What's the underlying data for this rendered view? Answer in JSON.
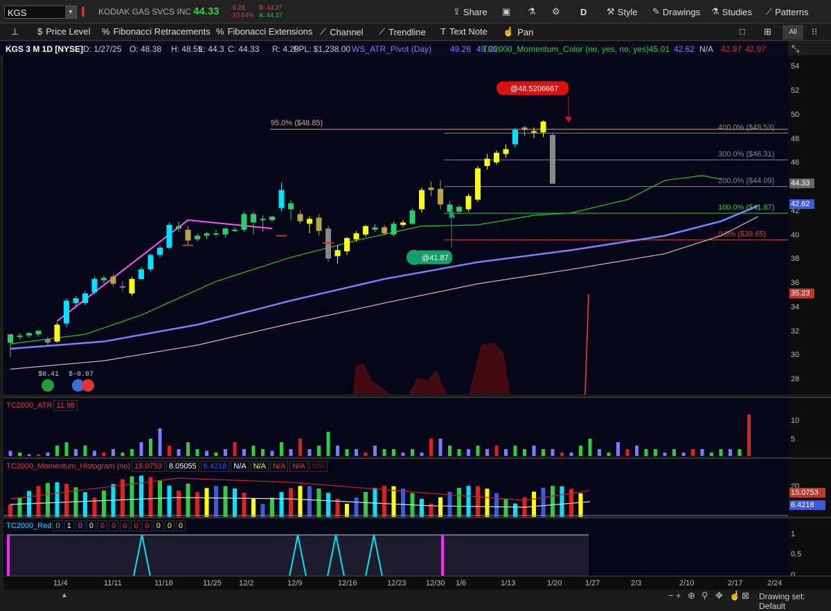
{
  "header": {
    "symbol": "KGS",
    "company": "KODIAK GAS SVCS INC",
    "last": "44.33",
    "change": "-5.28",
    "change_pct": "-10.64%",
    "bid": "B: 44.27",
    "ask": "A: 44.37",
    "buttons": {
      "share": "Share",
      "period": "D",
      "style": "Style",
      "drawings": "Drawings",
      "studies": "Studies",
      "patterns": "Patterns"
    }
  },
  "tools": {
    "price_level": "Price Level",
    "fib_ret": "Fibonacci Retracements",
    "fib_ext": "Fibonacci Extensions",
    "channel": "Channel",
    "trendline": "Trendline",
    "text_note": "Text Note",
    "pan": "Pan",
    "all": "All"
  },
  "info": {
    "title": "KGS 3 M 1D [NYSE]",
    "date": "D: 1/27/25",
    "open": "O: 48.38",
    "high": "H: 48.59",
    "low": "L: 44.3",
    "close": "C: 44.33",
    "range": "R: 4.29",
    "fpl": "FPL: $1,238.00",
    "pivot_name": "WS_ATR_Pivot (Day)",
    "pivot_v1": "49.26",
    "pivot_v2": "49.96",
    "mom_name": "TC2000_Momentum_Color (no, yes, no, yes)",
    "mom_v1": "45.01",
    "mom_v2": "42.62",
    "mom_na": "N/A",
    "mom_v3": "42.97",
    "mom_v4": "42.97"
  },
  "chart_data": {
    "type": "candlestick",
    "y_ticks": [
      "54",
      "52",
      "50",
      "48",
      "46",
      "44",
      "42",
      "40",
      "38",
      "36",
      "34",
      "32",
      "30",
      "28"
    ],
    "ylim": [
      26.8,
      55
    ],
    "x_ticks": [
      "11/4",
      "11/11",
      "11/18",
      "11/25",
      "12/2",
      "12/9",
      "12/16",
      "12/23",
      "12/30",
      "1/6",
      "1/13",
      "1/20",
      "1/27",
      "2/3",
      "2/10",
      "2/17",
      "2/24"
    ],
    "candles": [
      {
        "o": 31.1,
        "h": 31.8,
        "l": 29.9,
        "c": 31.8,
        "k": "#2ecc71"
      },
      {
        "o": 31.6,
        "h": 31.9,
        "l": 31.4,
        "c": 31.7,
        "k": "#2ecc71"
      },
      {
        "o": 31.7,
        "h": 32.0,
        "l": 31.5,
        "c": 31.9,
        "k": "#2ecc71"
      },
      {
        "o": 31.8,
        "h": 32.1,
        "l": 31.6,
        "c": 32.1,
        "k": "#2ecc71"
      },
      {
        "o": 31.4,
        "h": 31.6,
        "l": 30.9,
        "c": 31.1,
        "k": "#888888"
      },
      {
        "o": 31.2,
        "h": 32.8,
        "l": 31.1,
        "c": 32.6,
        "k": "#ffff00"
      },
      {
        "o": 32.7,
        "h": 34.8,
        "l": 32.4,
        "c": 34.6,
        "k": "#00e5ff"
      },
      {
        "o": 34.4,
        "h": 35.0,
        "l": 34.0,
        "c": 34.8,
        "k": "#00e5ff"
      },
      {
        "o": 34.4,
        "h": 35.4,
        "l": 34.2,
        "c": 35.2,
        "k": "#00e5ff"
      },
      {
        "o": 35.3,
        "h": 36.6,
        "l": 35.1,
        "c": 36.4,
        "k": "#00e5ff"
      },
      {
        "o": 36.3,
        "h": 36.7,
        "l": 36.0,
        "c": 36.5,
        "k": "#2ecc71"
      },
      {
        "o": 36.6,
        "h": 36.8,
        "l": 35.8,
        "c": 36.0,
        "k": "#b5a642"
      },
      {
        "o": 35.7,
        "h": 36.2,
        "l": 35.4,
        "c": 35.8,
        "k": "#888888"
      },
      {
        "o": 35.2,
        "h": 36.6,
        "l": 35.0,
        "c": 36.4,
        "k": "#ffff00"
      },
      {
        "o": 36.4,
        "h": 37.4,
        "l": 36.3,
        "c": 37.2,
        "k": "#00e5ff"
      },
      {
        "o": 37.2,
        "h": 38.5,
        "l": 37.0,
        "c": 38.4,
        "k": "#00e5ff"
      },
      {
        "o": 38.4,
        "h": 39.2,
        "l": 38.2,
        "c": 39.0,
        "k": "#00e5ff"
      },
      {
        "o": 39.0,
        "h": 41.1,
        "l": 38.9,
        "c": 40.9,
        "k": "#00e5ff"
      },
      {
        "o": 40.8,
        "h": 41.2,
        "l": 40.3,
        "c": 40.6,
        "k": "#2ecc71"
      },
      {
        "o": 40.5,
        "h": 40.8,
        "l": 39.2,
        "c": 39.6,
        "k": "#b5a642"
      },
      {
        "o": 39.7,
        "h": 40.2,
        "l": 39.5,
        "c": 40.0,
        "k": "#2ecc71"
      },
      {
        "o": 40.0,
        "h": 40.3,
        "l": 39.7,
        "c": 40.2,
        "k": "#2ecc71"
      },
      {
        "o": 40.2,
        "h": 40.5,
        "l": 39.9,
        "c": 40.1,
        "k": "#2ecc71"
      },
      {
        "o": 40.1,
        "h": 40.7,
        "l": 39.8,
        "c": 40.6,
        "k": "#2ecc71"
      },
      {
        "o": 40.5,
        "h": 40.7,
        "l": 40.3,
        "c": 40.4,
        "k": "#2ecc71"
      },
      {
        "o": 40.5,
        "h": 42.0,
        "l": 40.3,
        "c": 41.8,
        "k": "#2ecc71"
      },
      {
        "o": 41.8,
        "h": 42.0,
        "l": 40.1,
        "c": 41.1,
        "k": "#2ecc71"
      },
      {
        "o": 41.4,
        "h": 41.7,
        "l": 40.3,
        "c": 41.4,
        "k": "#2ecc71"
      },
      {
        "o": 41.3,
        "h": 41.6,
        "l": 41.1,
        "c": 41.6,
        "k": "#2ecc71"
      },
      {
        "o": 42.3,
        "h": 44.4,
        "l": 42.0,
        "c": 43.8,
        "k": "#00e5ff"
      },
      {
        "o": 42.2,
        "h": 43.0,
        "l": 41.3,
        "c": 42.7,
        "k": "#2ecc71"
      },
      {
        "o": 41.8,
        "h": 42.1,
        "l": 41.0,
        "c": 41.2,
        "k": "#b5a642"
      },
      {
        "o": 41.0,
        "h": 41.6,
        "l": 40.2,
        "c": 41.4,
        "k": "#ffff00"
      },
      {
        "o": 41.5,
        "h": 41.8,
        "l": 40.0,
        "c": 40.4,
        "k": "#b5a642"
      },
      {
        "o": 40.6,
        "h": 40.8,
        "l": 37.8,
        "c": 38.1,
        "k": "#888888"
      },
      {
        "o": 38.3,
        "h": 39.2,
        "l": 37.7,
        "c": 38.8,
        "k": "#ffff00"
      },
      {
        "o": 38.7,
        "h": 39.9,
        "l": 38.4,
        "c": 39.8,
        "k": "#ffff00"
      },
      {
        "o": 39.7,
        "h": 40.4,
        "l": 39.5,
        "c": 40.2,
        "k": "#ffff00"
      },
      {
        "o": 40.1,
        "h": 40.9,
        "l": 39.9,
        "c": 40.8,
        "k": "#ffff00"
      },
      {
        "o": 40.5,
        "h": 41.0,
        "l": 40.3,
        "c": 40.7,
        "k": "#2ecc71"
      },
      {
        "o": 40.7,
        "h": 40.9,
        "l": 40.0,
        "c": 40.2,
        "k": "#b5a642"
      },
      {
        "o": 40.1,
        "h": 41.2,
        "l": 39.9,
        "c": 41.0,
        "k": "#2ecc71"
      },
      {
        "o": 40.9,
        "h": 41.3,
        "l": 40.7,
        "c": 41.1,
        "k": "#ffff00"
      },
      {
        "o": 41.0,
        "h": 42.3,
        "l": 40.9,
        "c": 42.1,
        "k": "#2ecc71"
      },
      {
        "o": 42.2,
        "h": 44.0,
        "l": 41.9,
        "c": 43.8,
        "k": "#ffff00"
      },
      {
        "o": 43.8,
        "h": 44.5,
        "l": 43.3,
        "c": 44.0,
        "k": "#b5a642"
      },
      {
        "o": 43.9,
        "h": 44.6,
        "l": 42.2,
        "c": 42.6,
        "k": "#b5a642"
      },
      {
        "o": 42.6,
        "h": 42.9,
        "l": 41.6,
        "c": 42.0,
        "k": "#2ecc71"
      },
      {
        "o": 42.0,
        "h": 42.6,
        "l": 41.8,
        "c": 42.4,
        "k": "#2ecc71"
      },
      {
        "o": 42.2,
        "h": 43.5,
        "l": 42.0,
        "c": 43.3,
        "k": "#ffff00"
      },
      {
        "o": 43.0,
        "h": 45.8,
        "l": 42.8,
        "c": 45.6,
        "k": "#ffff00"
      },
      {
        "o": 45.8,
        "h": 46.8,
        "l": 45.5,
        "c": 46.4,
        "k": "#ffff00"
      },
      {
        "o": 46.1,
        "h": 47.1,
        "l": 45.9,
        "c": 46.9,
        "k": "#ffff00"
      },
      {
        "o": 46.8,
        "h": 47.6,
        "l": 46.5,
        "c": 47.2,
        "k": "#ffff00"
      },
      {
        "o": 47.6,
        "h": 49.0,
        "l": 47.3,
        "c": 48.8,
        "k": "#00e5ff"
      },
      {
        "o": 48.8,
        "h": 49.1,
        "l": 48.3,
        "c": 49.0,
        "k": "#b5a642"
      },
      {
        "o": 48.6,
        "h": 49.0,
        "l": 48.1,
        "c": 48.7,
        "k": "#ffff00"
      },
      {
        "o": 48.6,
        "h": 49.6,
        "l": 48.2,
        "c": 49.5,
        "k": "#ffff00"
      },
      {
        "o": 48.38,
        "h": 48.59,
        "l": 44.3,
        "c": 44.33,
        "k": "#888888"
      }
    ],
    "ma_green": [
      [
        0,
        31.0
      ],
      [
        8,
        31.8
      ],
      [
        14,
        33.4
      ],
      [
        22,
        36.2
      ],
      [
        30,
        38.2
      ],
      [
        37,
        39.6
      ],
      [
        44,
        40.8
      ],
      [
        50,
        40.9
      ],
      [
        56,
        41.7
      ],
      [
        60,
        41.9
      ],
      [
        66,
        43.0
      ],
      [
        70,
        44.6
      ],
      [
        74,
        45.0
      ],
      [
        76,
        44.7
      ]
    ],
    "ma_blue": [
      [
        0,
        30.6
      ],
      [
        10,
        31.2
      ],
      [
        20,
        32.6
      ],
      [
        30,
        34.6
      ],
      [
        40,
        36.4
      ],
      [
        50,
        37.8
      ],
      [
        60,
        38.8
      ],
      [
        70,
        40.0
      ],
      [
        76,
        41.2
      ],
      [
        80,
        42.5
      ]
    ],
    "ma_pink": [
      [
        0,
        28.9
      ],
      [
        10,
        29.6
      ],
      [
        20,
        30.9
      ],
      [
        30,
        32.7
      ],
      [
        40,
        34.4
      ],
      [
        50,
        36.0
      ],
      [
        60,
        37.2
      ],
      [
        70,
        38.5
      ],
      [
        76,
        40.0
      ],
      [
        80,
        41.6
      ]
    ],
    "fib_levels": [
      {
        "label": "400.0%  ($48.53)",
        "price": 48.53,
        "color": "#888888"
      },
      {
        "label": "300.0%  ($46.31)",
        "price": 46.31,
        "color": "#888888"
      },
      {
        "label": "200.0%  ($44.09)",
        "price": 44.09,
        "color": "#888888"
      },
      {
        "label": "100.0%  ($41.87)",
        "price": 41.87,
        "color": "#2ecc40"
      },
      {
        "label": "0.0%  ($39.65)",
        "price": 39.65,
        "color": "#e04040"
      }
    ],
    "fib_ret": {
      "label": "95.0%  ($48.85)",
      "price": 48.85
    },
    "alert_top": "@48.5206667",
    "alert_bottom": "@41.87",
    "price_tags": [
      {
        "v": "44.33",
        "color": "#666666"
      },
      {
        "v": "42.62",
        "color": "#3b5bdb"
      },
      {
        "v": "35.23",
        "color": "#c0392b"
      }
    ],
    "dividends": [
      "$0.41",
      "$-0.07"
    ]
  },
  "atr_pane": {
    "title": "TC2000_ATR",
    "value": "11.98",
    "ticks": [
      "10",
      "5"
    ],
    "values": [
      1.5,
      1,
      0.5,
      0.5,
      1,
      3,
      4,
      2,
      3,
      1.5,
      1,
      2,
      1,
      2,
      4,
      5,
      8,
      3,
      2,
      4,
      2,
      1.5,
      1,
      2,
      4,
      2,
      3,
      2,
      1.5,
      4,
      2,
      5,
      2,
      3,
      7,
      3,
      2,
      2,
      1,
      3,
      2,
      2,
      1,
      2,
      1,
      5,
      5,
      3,
      2,
      2,
      3,
      2,
      3,
      2,
      3,
      2,
      3,
      2,
      2,
      1,
      1,
      3,
      5,
      2,
      1,
      4,
      2,
      3,
      2,
      2,
      1,
      2,
      1,
      2,
      2,
      1,
      2,
      2,
      2,
      12
    ],
    "colors": [
      "#7b7bff",
      "#2ecc40",
      "#7b7bff",
      "#e02020",
      "#7b7bff",
      "#2ecc40",
      "#2ecc40"
    ]
  },
  "mom_pane": {
    "title": "TC2000_Momentum_Histogram (no)",
    "v1": "15.0753",
    "v2": "8.05055",
    "v3": "6.4218",
    "na": "N/A",
    "ticks": [
      "20"
    ],
    "tag_red": "15.0753",
    "tag_blue": "6.4218"
  },
  "red_pane": {
    "title": "TC2000_Red",
    "digits": [
      "0",
      "1",
      "0",
      "0",
      "0",
      "0",
      "0",
      "0",
      "0",
      "0",
      "0",
      "0"
    ],
    "ticks": [
      "1",
      "0.5",
      "0"
    ]
  },
  "footer": {
    "drawing_set": "Drawing set: Default"
  }
}
